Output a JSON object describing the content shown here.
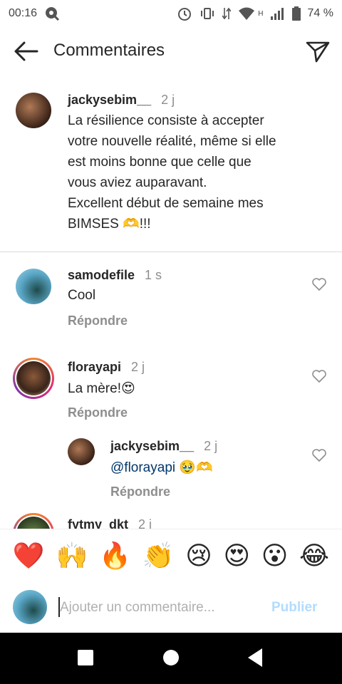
{
  "status_bar": {
    "time": "00:16",
    "network": "H",
    "battery": "74 %"
  },
  "header": {
    "title": "Commentaires"
  },
  "caption": {
    "username": "jackysebim__",
    "time": "2 j",
    "lines": [
      "La résilience consiste à accepter",
      "votre nouvelle réalité, même si elle",
      "est moins bonne que celle que",
      "vous aviez auparavant.",
      "Excellent début de semaine mes",
      "BIMSES 🫶!!!"
    ]
  },
  "comments": [
    {
      "username": "samodefile",
      "time": "1 s",
      "text": "Cool",
      "reply_label": "Répondre"
    },
    {
      "username": "florayapi",
      "time": "2 j",
      "text": "La mère!😍",
      "reply_label": "Répondre"
    },
    {
      "username": "jackysebim__",
      "time": "2 j",
      "mention": "@florayapi",
      "text": " 🥹🫶",
      "reply_label": "Répondre"
    },
    {
      "username": "fytmy_dkt",
      "time": "2 j"
    }
  ],
  "emoji_bar": [
    "❤️",
    "🙌",
    "🔥",
    "👏",
    "😢",
    "😍",
    "😮",
    "😂"
  ],
  "composer": {
    "placeholder": "Ajouter un commentaire...",
    "publish_label": "Publier"
  },
  "colors": {
    "accent": "#0095f6",
    "muted": "#8e8e8e",
    "publish_disabled": "#b3dbff"
  }
}
